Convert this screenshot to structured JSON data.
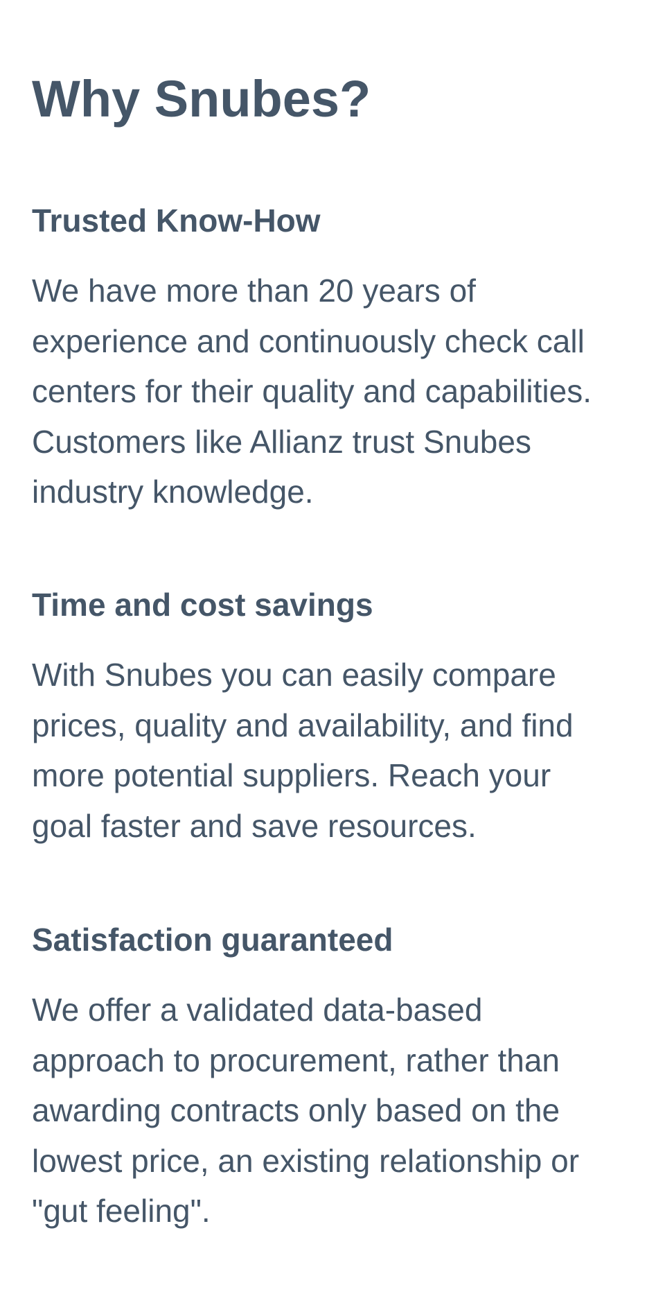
{
  "page": {
    "title": "Why Snubes?"
  },
  "features": [
    {
      "heading": "Trusted Know-How",
      "text": "We have more than 20 years of\nexperience and continuously check call\ncenters for their quality and capabilities.\nCustomers like Allianz trust Snubes\nindustry knowledge."
    },
    {
      "heading": "Time and cost savings",
      "text": "With Snubes you can easily compare\nprices, quality and availability, and find\nmore potential suppliers. Reach your\ngoal faster and save resources."
    },
    {
      "heading": "Satisfaction guaranteed",
      "text": "We offer a validated data-based\napproach to procurement, rather than\nawarding contracts only based on the\nlowest price, an existing relationship or\n\"gut feeling\"."
    }
  ]
}
